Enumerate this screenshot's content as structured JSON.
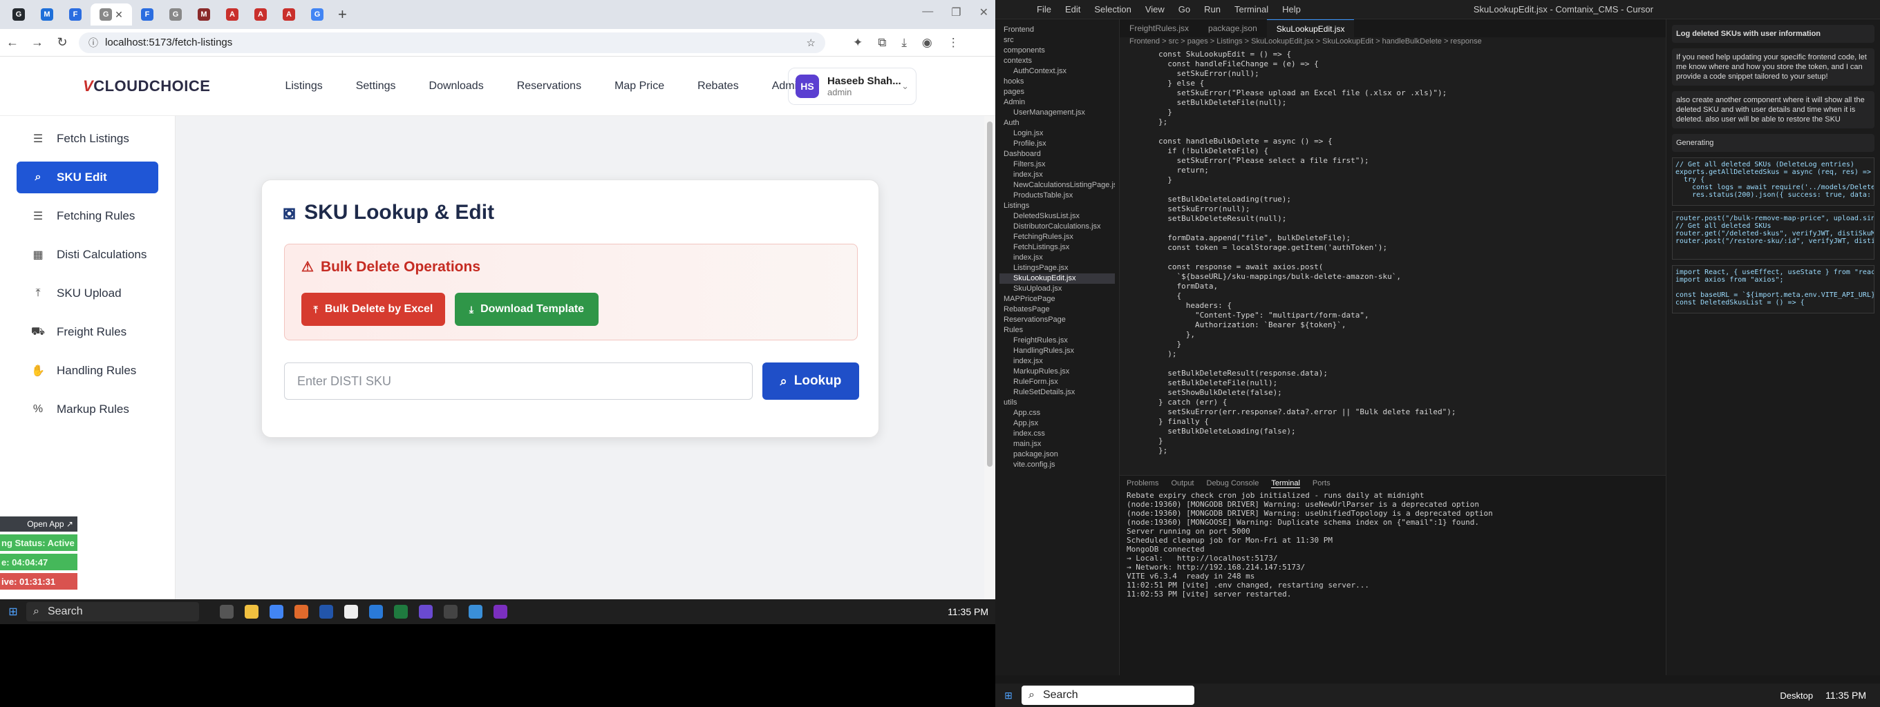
{
  "browser": {
    "url": "localhost:5173/fetch-listings",
    "tabs": [
      {
        "icon": "github-icon",
        "color": "#24292e",
        "letter": "G"
      },
      {
        "icon": "m-icon",
        "color": "#1e6fd9",
        "letter": "M"
      },
      {
        "icon": "f-icon",
        "color": "#2b6de0",
        "letter": "F"
      },
      {
        "icon": "g2-icon",
        "color": "#888888",
        "letter": "G"
      },
      {
        "icon": "f-icon",
        "color": "#2b6de0",
        "letter": "F"
      },
      {
        "icon": "g2-icon",
        "color": "#888888",
        "letter": "G"
      },
      {
        "icon": "m-icon",
        "color": "#8a2a2a",
        "letter": "M"
      },
      {
        "icon": "a-icon",
        "color": "#c9302c",
        "letter": "A"
      },
      {
        "icon": "a-icon",
        "color": "#c9302c",
        "letter": "A"
      },
      {
        "icon": "a-icon",
        "color": "#c9302c",
        "letter": "A"
      },
      {
        "icon": "google-icon",
        "color": "#4285f4",
        "letter": "G"
      }
    ]
  },
  "app": {
    "logo": "CLOUDCHOICE",
    "nav": [
      "Listings",
      "Settings",
      "Downloads",
      "Reservations",
      "Map Price",
      "Rebates",
      "Admin"
    ],
    "user": {
      "initials": "HS",
      "name": "Haseeb Shah...",
      "role": "admin"
    }
  },
  "sidebar": {
    "items": [
      {
        "label": "Fetch Listings",
        "icon": "list-icon",
        "active": false
      },
      {
        "label": "SKU Edit",
        "icon": "search-icon",
        "active": true
      },
      {
        "label": "Fetching Rules",
        "icon": "list-icon",
        "active": false
      },
      {
        "label": "Disti Calculations",
        "icon": "calculator-icon",
        "active": false
      },
      {
        "label": "SKU Upload",
        "icon": "upload-icon",
        "active": false
      },
      {
        "label": "Freight Rules",
        "icon": "truck-icon",
        "active": false
      },
      {
        "label": "Handling Rules",
        "icon": "hand-icon",
        "active": false
      },
      {
        "label": "Markup Rules",
        "icon": "percent-icon",
        "active": false
      }
    ]
  },
  "card": {
    "title": "SKU Lookup & Edit",
    "bulk": {
      "title": "Bulk Delete Operations",
      "delete_label": "Bulk Delete by Excel",
      "template_label": "Download Template"
    },
    "input_placeholder": "Enter DISTI SKU",
    "lookup_label": "Lookup"
  },
  "popup": {
    "open_app": "Open App ↗",
    "status": "ng Status: Active",
    "time1": "e: 04:04:47",
    "time2": "ive: 01:31:31"
  },
  "taskbar_left": {
    "search": "Search",
    "time": "11:35 PM"
  },
  "cursor": {
    "title": "SkuLookupEdit.jsx - Comtanix_CMS - Cursor",
    "menu": [
      "File",
      "Edit",
      "Selection",
      "View",
      "Go",
      "Run",
      "Terminal",
      "Help"
    ],
    "tabs": [
      "FreightRules.jsx",
      "package.json",
      "SkuLookupEdit.jsx"
    ],
    "breadcrumb": "Frontend > src > pages > Listings > SkuLookupEdit.jsx > SkuLookupEdit > handleBulkDelete > response",
    "tree": [
      "Frontend",
      "src",
      "components",
      "contexts",
      "AuthContext.jsx",
      "hooks",
      "pages",
      "Admin",
      "UserManagement.jsx",
      "Auth",
      "Login.jsx",
      "Profile.jsx",
      "Dashboard",
      "Filters.jsx",
      "index.jsx",
      "NewCalculationsListingPage.jsx",
      "ProductsTable.jsx",
      "Listings",
      "DeletedSkusList.jsx",
      "DistributorCalculations.jsx",
      "FetchingRules.jsx",
      "FetchListings.jsx",
      "index.jsx",
      "ListingsPage.jsx",
      "SkuLookupEdit.jsx",
      "SkuUpload.jsx",
      "MAPPricePage",
      "RebatesPage",
      "ReservationsPage",
      "Rules",
      "FreightRules.jsx",
      "HandlingRules.jsx",
      "index.jsx",
      "MarkupRules.jsx",
      "RuleForm.jsx",
      "RuleSetDetails.jsx",
      "utils",
      "App.css",
      "App.jsx",
      "index.css",
      "main.jsx",
      "package.json",
      "vite.config.js"
    ],
    "code": [
      "const SkuLookupEdit = () => {",
      "  const handleFileChange = (e) => {",
      "    setSkuError(null);",
      "  } else {",
      "    setSkuError(\"Please upload an Excel file (.xlsx or .xls)\");",
      "    setBulkDeleteFile(null);",
      "  }",
      "};",
      "",
      "const handleBulkDelete = async () => {",
      "  if (!bulkDeleteFile) {",
      "    setSkuError(\"Please select a file first\");",
      "    return;",
      "  }",
      "",
      "  setBulkDeleteLoading(true);",
      "  setSkuError(null);",
      "  setBulkDeleteResult(null);",
      "",
      "  formData.append(\"file\", bulkDeleteFile);",
      "  const token = localStorage.getItem('authToken');",
      "",
      "  const response = await axios.post(",
      "    `${baseURL}/sku-mappings/bulk-delete-amazon-sku`,",
      "    formData,",
      "    {",
      "      headers: {",
      "        \"Content-Type\": \"multipart/form-data\",",
      "        Authorization: `Bearer ${token}`,",
      "      },",
      "    }",
      "  );",
      "",
      "  setBulkDeleteResult(response.data);",
      "  setBulkDeleteFile(null);",
      "  setShowBulkDelete(false);",
      "} catch (err) {",
      "  setSkuError(err.response?.data?.error || \"Bulk delete failed\");",
      "} finally {",
      "  setBulkDeleteLoading(false);",
      "}",
      "};"
    ],
    "terminal_tabs": [
      "Problems",
      "Output",
      "Debug Console",
      "Terminal",
      "Ports"
    ],
    "terminal": [
      "Rebate expiry check cron job initialized - runs daily at midnight",
      "(node:19360) [MONGODB DRIVER] Warning: useNewUrlParser is a deprecated option",
      "(node:19360) [MONGODB DRIVER] Warning: useUnifiedTopology is a deprecated option",
      "(node:19360) [MONGOOSE] Warning: Duplicate schema index on {\"email\":1} found.",
      "Server running on port 5000",
      "Scheduled cleanup job for Mon-Fri at 11:30 PM",
      "MongoDB connected",
      "→ Local:   http://localhost:5173/",
      "→ Network: http://192.168.214.147:5173/",
      "VITE v6.3.4  ready in 248 ms",
      "11:02:51 PM [vite] .env changed, restarting server...",
      "11:02:53 PM [vite] server restarted."
    ],
    "chat": {
      "header": "Log deleted SKUs with user information",
      "msg1": "If you need help updating your specific frontend code, let me know where and how you store the token, and I can provide a code snippet tailored to your setup!",
      "msg2": "also create another component where it will show all the deleted SKU and with user details and time when it is deleted. also user will be able to restore the SKU",
      "status": "Generating",
      "code1": "// Get all deleted SKUs (DeleteLog entries)\nexports.getAllDeletedSkus = async (req, res) => {\n  try {\n    const logs = await require('../models/DeleteLog').find\n    res.status(200).json({ success: true, data: logs });",
      "code2": "router.post(\"/bulk-remove-map-price\", upload.single(\"file\"),\n// Get all deleted SKUs\nrouter.get(\"/deleted-skus\", verifyJWT, distiSkuMappingControl\nrouter.post(\"/restore-sku/:id\", verifyJWT, distiSkuMappingCon",
      "code3": "import React, { useEffect, useState } from \"react\";\nimport axios from \"axios\";\n\nconst baseURL = `${import.meta.env.VITE_API_URL}`;\nconst DeletedSkusList = () => {"
    },
    "taskbar": {
      "search": "Search",
      "time": "11:35 PM",
      "desktop": "Desktop"
    }
  }
}
